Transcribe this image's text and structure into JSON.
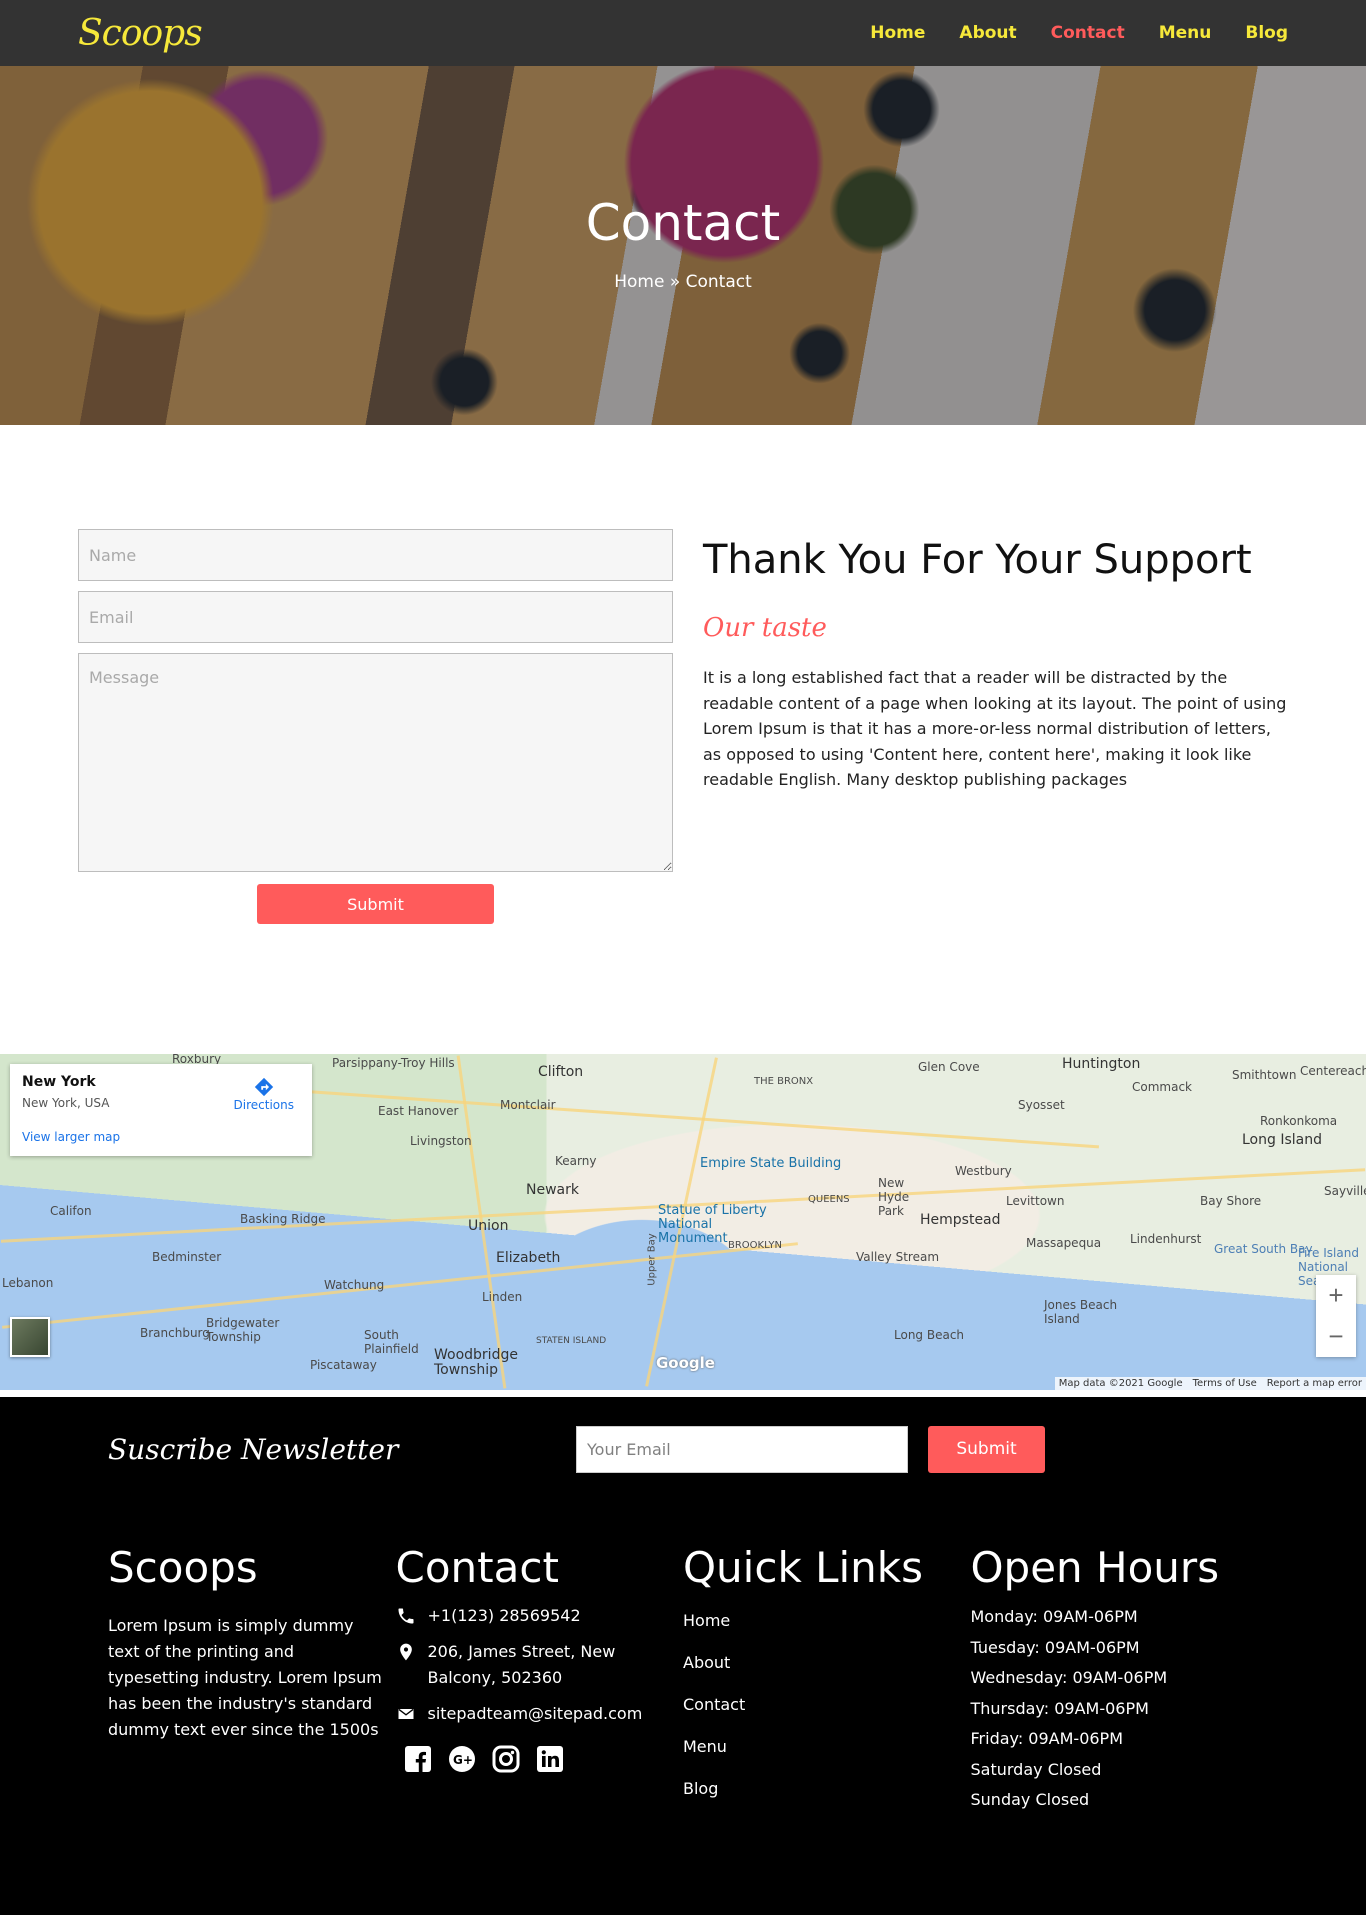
{
  "nav": {
    "logo": "Scoops",
    "links": [
      "Home",
      "About",
      "Contact",
      "Menu",
      "Blog"
    ]
  },
  "hero": {
    "title": "Contact",
    "breadcrumb": "Home » Contact"
  },
  "form": {
    "name_placeholder": "Name",
    "email_placeholder": "Email",
    "message_placeholder": "Message",
    "submit_label": "Submit"
  },
  "intro": {
    "heading": "Thank You For Your Support",
    "tagline": "Our taste",
    "body": "It is a long established fact that a reader will be distracted by the readable content of a page when looking at its layout. The point of using Lorem Ipsum is that it has a more-or-less normal distribution of letters, as opposed to using 'Content here, content here', making it look like readable English. Many desktop publishing packages"
  },
  "map": {
    "place_name": "New York",
    "place_address": "New York, USA",
    "directions_label": "Directions",
    "larger_map_label": "View larger map",
    "labels": [
      "Roxbury",
      "Parsippany-Troy Hills",
      "Clifton",
      "THE BRONX",
      "Glen Cove",
      "Huntington",
      "Smithtown",
      "Centereach",
      "Commack",
      "Syosset",
      "Ronkonkoma",
      "Long Island",
      "East Hanover",
      "Montclair",
      "Livingston",
      "Kearny",
      "Empire State Building",
      "Newark",
      "Statue of Liberty National Monument",
      "QUEENS",
      "New Hyde Park",
      "Westbury",
      "Hempstead",
      "Levittown",
      "Bay Shore",
      "Califon",
      "Basking Ridge",
      "Union",
      "Elizabeth",
      "BROOKLYN",
      "Valley Stream",
      "Massapequa",
      "Lindenhurst",
      "Great South Bay",
      "Fire Island National Seashore",
      "Bedminster",
      "Lebanon",
      "Watchung",
      "Linden",
      "Jones Beach Island",
      "Branchburg",
      "Bridgewater Township",
      "South Plainfield",
      "STATEN ISLAND",
      "Woodbridge Township",
      "Piscataway",
      "Long Beach",
      "Upper Bay",
      "Sayville"
    ],
    "google_mark": "Google",
    "attribution": [
      "Map data ©2021 Google",
      "Terms of Use",
      "Report a map error"
    ],
    "zoom_in": "+",
    "zoom_out": "−"
  },
  "newsletter": {
    "title": "Suscribe Newsletter",
    "email_placeholder": "Your Email",
    "submit_label": "Submit"
  },
  "footer": {
    "brand_title": "Scoops",
    "brand_text": "Lorem Ipsum is simply dummy text of the printing and typesetting industry. Lorem Ipsum has been the industry's standard dummy text ever since the 1500s",
    "contact_title": "Contact",
    "phone": "+1(123) 28569542",
    "address": "206, James Street, New Balcony, 502360",
    "email": "sitepadteam@sitepad.com",
    "socials": [
      "facebook-icon",
      "google-plus-icon",
      "instagram-icon",
      "linkedin-icon"
    ],
    "quicklinks_title": "Quick Links",
    "quicklinks": [
      "Home",
      "About",
      "Contact",
      "Menu",
      "Blog"
    ],
    "hours_title": "Open Hours",
    "hours": [
      "Monday: 09AM-06PM",
      "Tuesday: 09AM-06PM",
      "Wednesday: 09AM-06PM",
      "Thursday: 09AM-06PM",
      "Friday: 09AM-06PM",
      "Saturday Closed",
      "Sunday Closed"
    ]
  },
  "colors": {
    "nav_bg": "#333333",
    "nav_link": "#f6e83a",
    "accent": "#ff5b5b",
    "footer_bg": "#000000"
  }
}
